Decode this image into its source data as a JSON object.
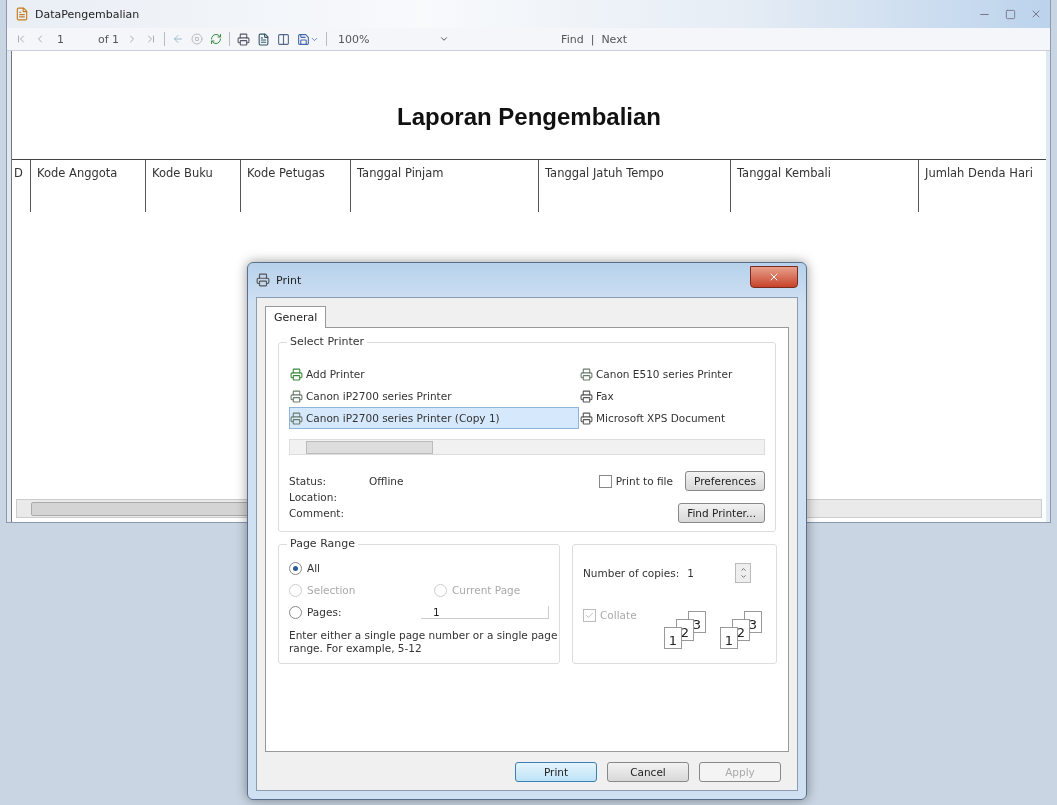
{
  "window": {
    "title": "DataPengembalian"
  },
  "toolbar": {
    "page": "1",
    "of_pages": "of 1",
    "zoom": "100%",
    "find": "Find",
    "separator": "|",
    "next": "Next"
  },
  "report": {
    "title": "Laporan Pengembalian",
    "columns": [
      "D",
      "Kode Anggota",
      "Kode Buku",
      "Kode Petugas",
      "Tanggal Pinjam",
      "Tanggal Jatuh Tempo",
      "Tanggal Kembali",
      "Jumlah Denda Hari"
    ]
  },
  "print_dialog": {
    "title": "Print",
    "tabs": [
      {
        "label": "General",
        "selected": true
      }
    ],
    "select_printer": {
      "legend": "Select Printer",
      "printers": [
        {
          "name": "Add Printer",
          "kind": "add",
          "selected": false
        },
        {
          "name": "Canon iP2700 series Printer",
          "kind": "printer",
          "selected": false
        },
        {
          "name": "Canon iP2700 series Printer (Copy 1)",
          "kind": "printer",
          "selected": true
        },
        {
          "name": "Canon E510 series Printer",
          "kind": "printer",
          "selected": false
        },
        {
          "name": "Fax",
          "kind": "fax",
          "selected": false
        },
        {
          "name": "Microsoft XPS Document",
          "kind": "fax",
          "selected": false
        }
      ],
      "status_label": "Status:",
      "status": "Offline",
      "location_label": "Location:",
      "comment_label": "Comment:",
      "print_to_file": {
        "label": "Print to file",
        "checked": false
      },
      "preferences": "Preferences",
      "find_printer": "Find Printer..."
    },
    "page_range": {
      "legend": "Page Range",
      "options": [
        {
          "label": "All",
          "selected": true,
          "disabled": false
        },
        {
          "label": "Selection",
          "selected": false,
          "disabled": true
        },
        {
          "label": "Current Page",
          "selected": false,
          "disabled": true
        },
        {
          "label": "Pages:",
          "selected": false,
          "disabled": false
        }
      ],
      "pages_value": "1",
      "hint": "Enter either a single page number or a single page range.  For example, 5-12"
    },
    "copies": {
      "label": "Number of copies:",
      "value": "1",
      "collate": {
        "label": "Collate",
        "checked": true,
        "disabled": true
      },
      "collate_illustration": [
        [
          "1",
          "2",
          "3"
        ],
        [
          "1",
          "2",
          "3"
        ]
      ]
    },
    "buttons": [
      {
        "label": "Print",
        "default": true,
        "disabled": false
      },
      {
        "label": "Cancel",
        "default": false,
        "disabled": false
      },
      {
        "label": "Apply",
        "default": false,
        "disabled": true
      }
    ]
  }
}
